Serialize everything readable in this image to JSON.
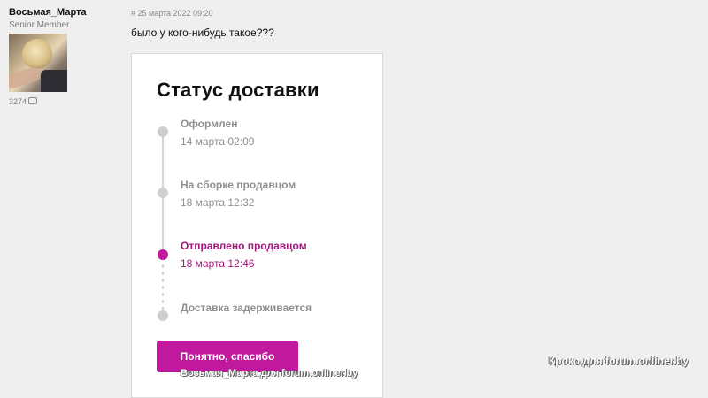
{
  "user": {
    "name": "Восьмая_Марта",
    "rank": "Senior Member",
    "post_count": "3274"
  },
  "post": {
    "meta": "# 25 марта 2022 09:20",
    "text": "было у кого-нибудь такое???"
  },
  "card": {
    "title": "Статус доставки",
    "steps": [
      {
        "label": "Оформлен",
        "time": "14 марта 02:09"
      },
      {
        "label": "На сборке продавцом",
        "time": "18 марта 12:32"
      },
      {
        "label": "Отправлено продавцом",
        "time": "18 марта 12:46"
      },
      {
        "label": "Доставка задерживается",
        "time": ""
      }
    ],
    "button_label": "Понятно, спасибо",
    "active_color": "#c0199d",
    "inactive_color": "#cfcfcf"
  },
  "watermark": {
    "right": "Кроко для forum.onliner.by",
    "bottom": "Восьмая_Марта для forum.onliner.by"
  },
  "icons": {
    "comment": "comment-icon",
    "avatar": "avatar"
  }
}
